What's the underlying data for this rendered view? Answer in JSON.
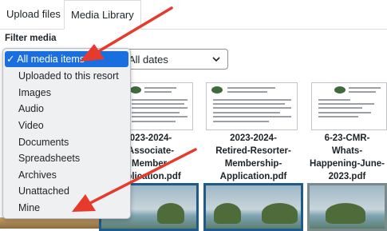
{
  "tabs": {
    "upload": "Upload files",
    "library": "Media Library"
  },
  "filter": {
    "label": "Filter media",
    "options": [
      {
        "label": "All media items",
        "selected": true
      },
      {
        "label": "Uploaded to this resort"
      },
      {
        "label": "Images"
      },
      {
        "label": "Audio"
      },
      {
        "label": "Video"
      },
      {
        "label": "Documents"
      },
      {
        "label": "Spreadsheets"
      },
      {
        "label": "Archives"
      },
      {
        "label": "Unattached"
      },
      {
        "label": "Mine"
      }
    ],
    "check_glyph": "✓"
  },
  "dates": {
    "value": "All dates"
  },
  "media": {
    "docs": [
      {
        "name_lines": [
          "023-2024-",
          "Associate-",
          "Member-",
          "pplication.pdf"
        ]
      },
      {
        "name_lines": [
          "2023-2024-",
          "Retired-Resorter-",
          "Membership-",
          "Application.pdf"
        ]
      },
      {
        "name_lines": [
          "6-23-CMR-",
          "Whats-",
          "Happening-June-",
          "2023.pdf"
        ]
      }
    ]
  },
  "colors": {
    "selection": "#1a6fe0",
    "arrow": "#e53a2c",
    "photo_border": "#1e5b8a"
  }
}
